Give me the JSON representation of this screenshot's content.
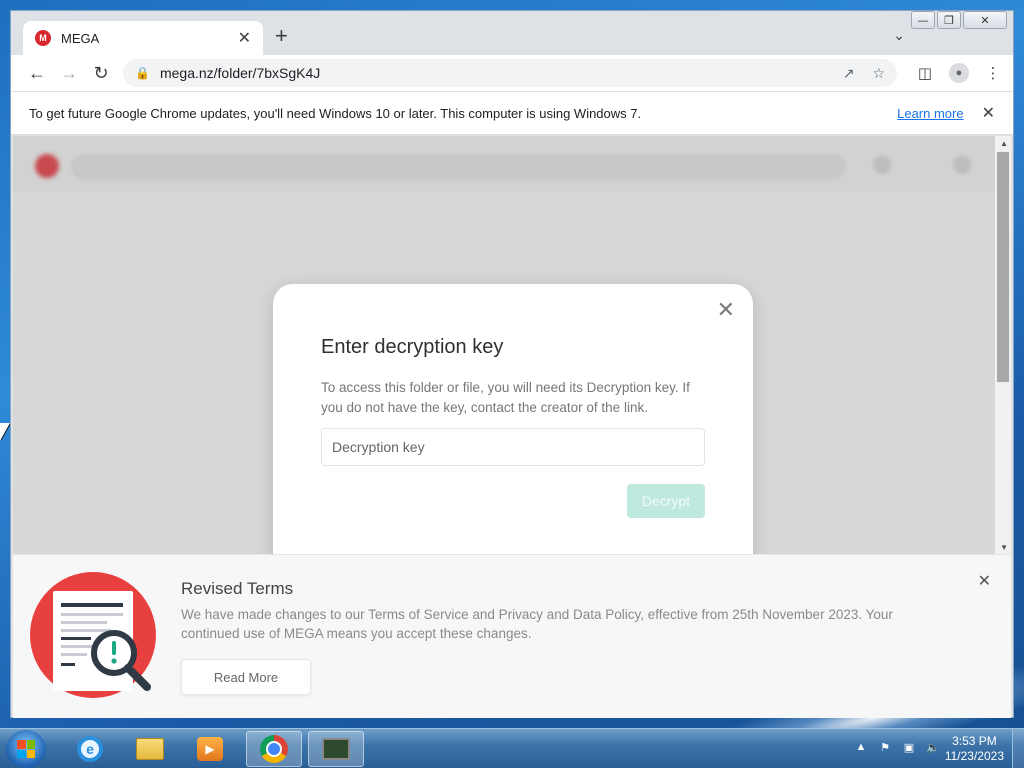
{
  "tab": {
    "favicon_letter": "M",
    "title": "MEGA",
    "close": "✕",
    "new_tab": "+"
  },
  "toolbar": {
    "url": "mega.nz/folder/7bxSgK4J"
  },
  "infobar": {
    "text": "To get future Google Chrome updates, you'll need Windows 10 or later. This computer is using Windows 7.",
    "link": "Learn more",
    "close": "✕"
  },
  "modal": {
    "close": "✕",
    "title": "Enter decryption key",
    "description": "To access this folder or file, you will need its Decryption key. If you do not have the key, contact the creator of the link.",
    "input_placeholder": "Decryption key",
    "decrypt_label": "Decrypt",
    "accent_color": "#bfe8de"
  },
  "terms": {
    "title": "Revised Terms",
    "text": "We have made changes to our Terms of Service and Privacy and Data Policy, effective from 25th November 2023. Your continued use of MEGA means you accept these changes.",
    "read_more": "Read More",
    "close": "✕"
  },
  "taskbar": {
    "time": "3:53 PM",
    "date": "11/23/2023",
    "apps": [
      "internet-explorer",
      "windows-explorer",
      "media-player",
      "google-chrome",
      "task-manager"
    ]
  },
  "colors": {
    "brand": "#d9272e",
    "chrome_blue": "#1a73e8"
  }
}
